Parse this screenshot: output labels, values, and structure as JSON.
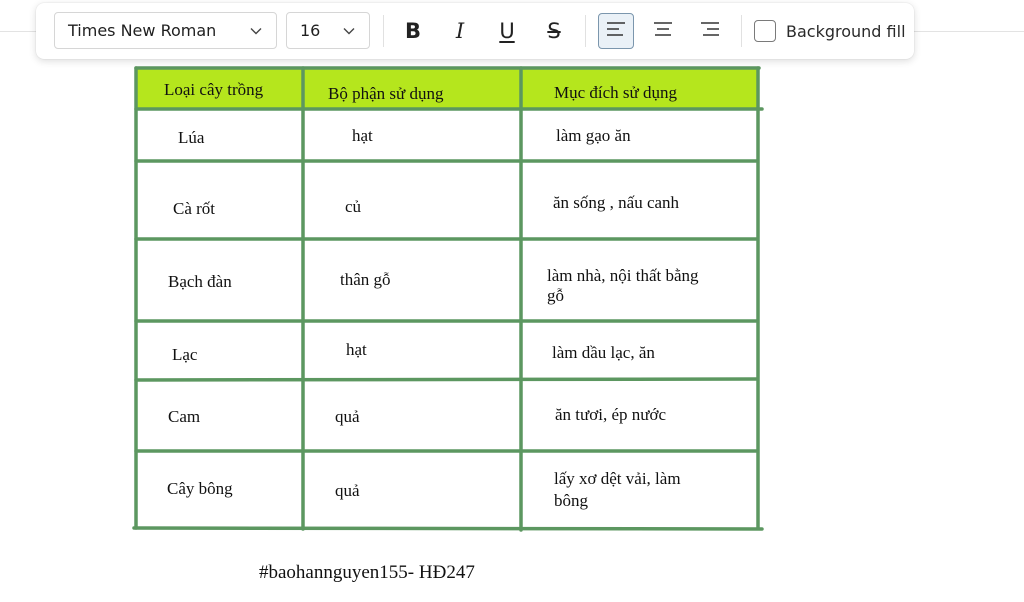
{
  "toolbar": {
    "font_family": "Times New Roman",
    "font_size": "16",
    "bold_icon": "B",
    "italic_icon": "I",
    "underline_icon": "U",
    "strike_icon": "S",
    "align_left_icon": "align-left-icon",
    "align_center_icon": "align-center-icon",
    "align_right_icon": "align-right-icon",
    "background_fill_label": "Background fill",
    "background_fill_checked": false
  },
  "table": {
    "headers": [
      "Loại cây trồng",
      "Bộ phận sử dụng",
      "Mục đích sử dụng"
    ],
    "rows": [
      [
        "Lúa",
        "hạt",
        "làm gạo ăn"
      ],
      [
        "Cà rốt",
        "củ",
        "ăn sống , nấu canh"
      ],
      [
        "Bạch đàn",
        "thân gỗ",
        "làm nhà, nội thất bằng",
        "gỗ"
      ],
      [
        "Lạc",
        "hạt",
        "làm dầu lạc, ăn"
      ],
      [
        "Cam",
        "quả",
        "ăn tươi, ép nước"
      ],
      [
        "Cây bông",
        "quả",
        "lấy xơ dệt vải, làm",
        "bông"
      ]
    ],
    "colors": {
      "header_fill": "#b5e61d",
      "grid": "#5a9a5f"
    }
  },
  "caption": "#baohannguyen155- HĐ247"
}
